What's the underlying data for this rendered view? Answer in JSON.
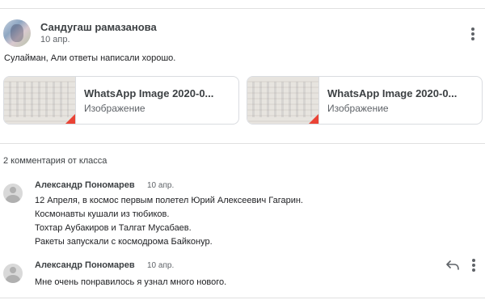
{
  "post": {
    "author": "Сандугаш рамазанова",
    "date": "10 апр.",
    "text": "Сулайман, Али ответы написали хорошо.",
    "attachments": [
      {
        "title": "WhatsApp Image 2020-0...",
        "type": "Изображение"
      },
      {
        "title": "WhatsApp Image 2020-0...",
        "type": "Изображение"
      }
    ]
  },
  "comments_header": "2 комментария от класса",
  "comments": [
    {
      "author": "Александр Пономарев",
      "date": "10 апр.",
      "lines": [
        "12 Апреля, в космос первым полетел Юрий Алексеевич Гагарин.",
        "Космонавты кушали из тюбиков.",
        "Тохтар Аубакиров и Талгат Мусабаев.",
        "Ракеты запускали с космодрома Байконур."
      ]
    },
    {
      "author": "Александр Пономарев",
      "date": "10 апр.",
      "lines": [
        "Мне очень понравилось я узнал много нового."
      ]
    }
  ],
  "icons": {
    "menu": "more-vert-icon",
    "reply": "reply-icon"
  },
  "colors": {
    "thumb_flag": "#ea4335",
    "divider": "#e0e0e0"
  }
}
